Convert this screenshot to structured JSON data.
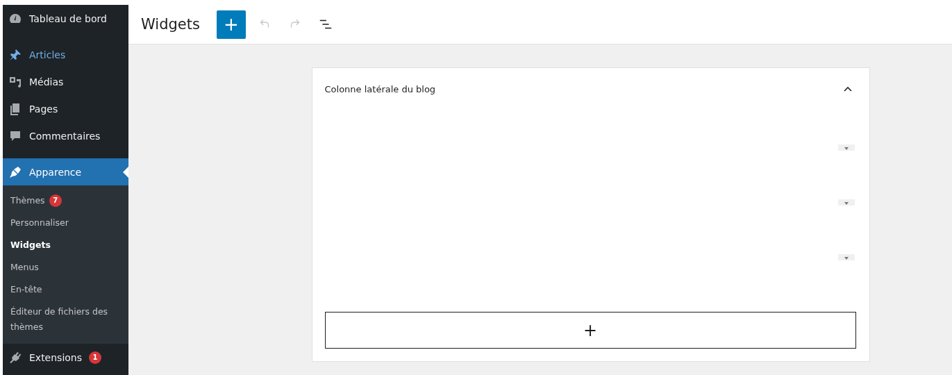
{
  "sidebar": {
    "top_items": [
      {
        "label": "Tableau de bord",
        "hover": false,
        "selected": false
      },
      {
        "label": "Articles",
        "hover": true,
        "selected": false
      },
      {
        "label": "Médias",
        "hover": false,
        "selected": false
      },
      {
        "label": "Pages",
        "hover": false,
        "selected": false
      },
      {
        "label": "Commentaires",
        "hover": false,
        "selected": false
      },
      {
        "label": "Apparence",
        "hover": false,
        "selected": true
      }
    ],
    "submenu": [
      {
        "label": "Thèmes",
        "badge": "7",
        "selected": false
      },
      {
        "label": "Personnaliser",
        "selected": false
      },
      {
        "label": "Widgets",
        "selected": true
      },
      {
        "label": "Menus",
        "selected": false
      },
      {
        "label": "En-tête",
        "selected": false
      },
      {
        "label": "Éditeur de fichiers des thèmes",
        "selected": false
      }
    ],
    "bottom_items": [
      {
        "label": "Extensions",
        "badge": "1",
        "hover": false,
        "selected": false
      }
    ]
  },
  "header": {
    "title": "Widgets",
    "add_button": "+",
    "undo_disabled": true,
    "redo_disabled": true
  },
  "widget_area": {
    "title": "Colonne latérale du blog",
    "expanded": true,
    "blocks": [
      {
        "kind": "placeholder"
      },
      {
        "kind": "placeholder"
      },
      {
        "kind": "placeholder"
      }
    ],
    "add_block": "+"
  }
}
